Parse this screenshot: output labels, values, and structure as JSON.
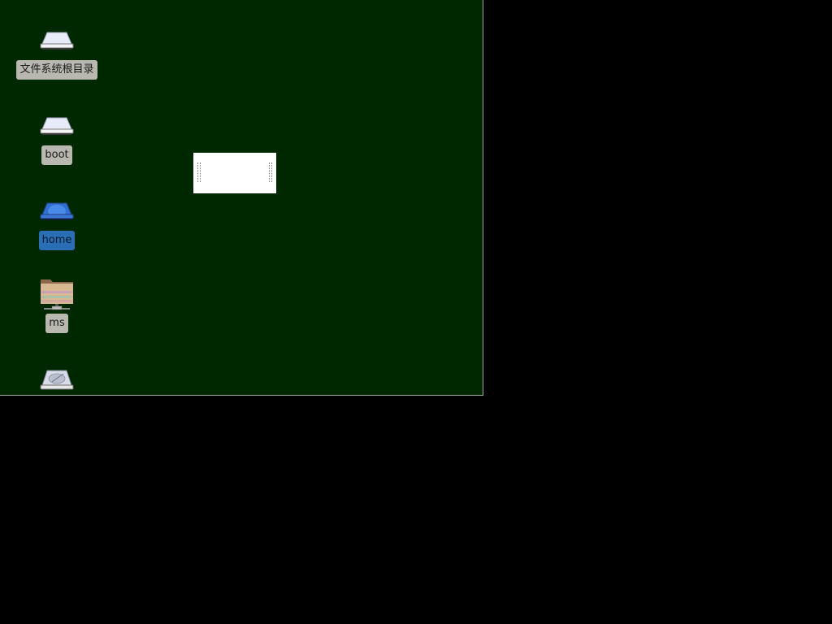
{
  "desktop": {
    "background": "#002800",
    "icons": [
      {
        "label": "文件系统根目录",
        "icon": "drive-icon",
        "selected": false
      },
      {
        "label": "boot",
        "icon": "drive-icon",
        "selected": false
      },
      {
        "label": "home",
        "icon": "drive-icon",
        "selected": true
      },
      {
        "label": "ms",
        "icon": "network-folder-icon",
        "selected": false
      },
      {
        "label": "",
        "icon": "hard-disk-icon",
        "selected": false
      }
    ]
  },
  "colors": {
    "selected_label": "#2a6fb5",
    "label_bg": "#b8b8b0",
    "screen_bg": "#000000"
  }
}
